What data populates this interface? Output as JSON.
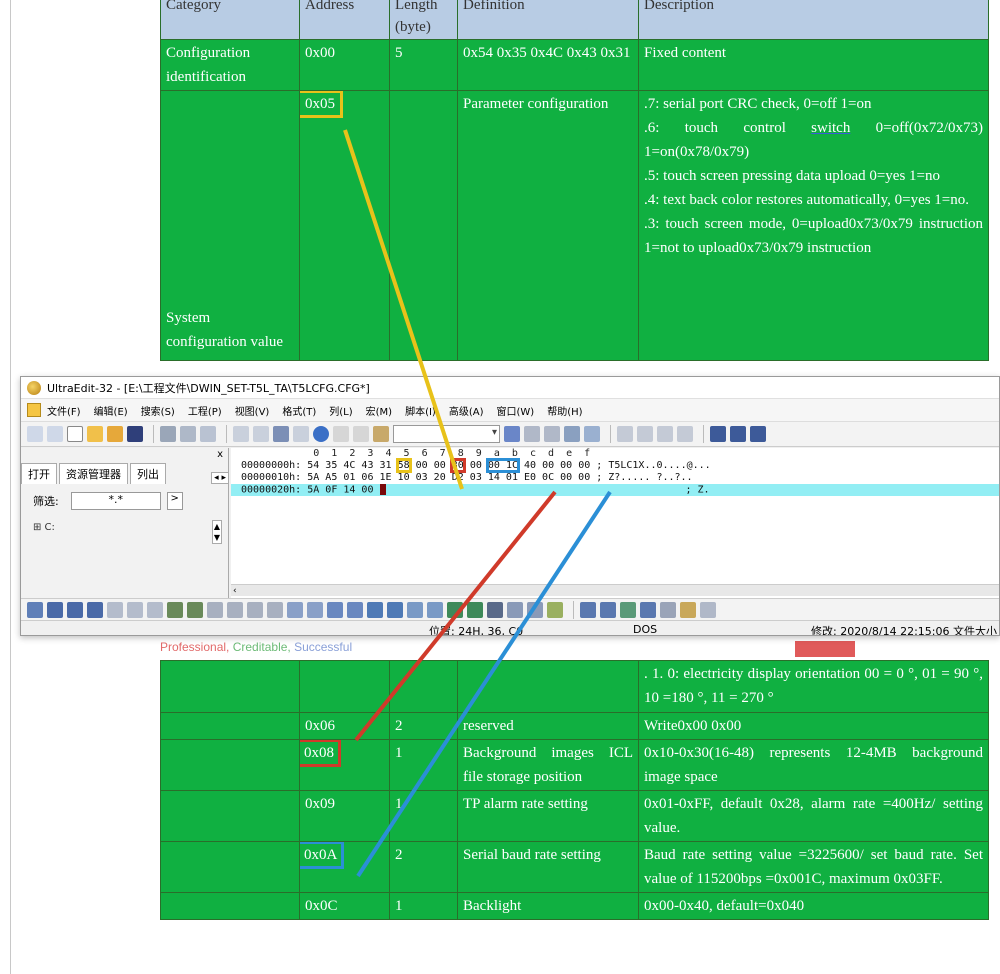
{
  "doc_table_top": {
    "headers": [
      "Category",
      "Address",
      "Length (byte)",
      "Definition",
      "Description"
    ],
    "row1": {
      "category": "Configuration identification",
      "address": "0x00",
      "length": "5",
      "definition": "0x54 0x35 0x4C 0x43 0x31",
      "description": "Fixed content"
    },
    "row2": {
      "category": "System configuration value",
      "address": "0x05",
      "definition": "Parameter configuration",
      "desc": {
        "l1": ".7: serial port CRC check, 0=off 1=on",
        "l2a": ".6: touch control ",
        "l2link": "switch",
        "l2b": " 0=off(0x72/0x73) 1=on(0x78/0x79)",
        "l3": ".5: touch screen pressing data upload 0=yes 1=no",
        "l4": ".4: text back color restores automatically, 0=yes 1=no.",
        "l5": ".3: touch screen mode, 0=upload0x73/0x79 instruction 1=not to upload0x73/0x79 instruction"
      }
    }
  },
  "slogan": {
    "professional": "Professional,",
    "creditable": " Creditable,",
    "successful": " Successful"
  },
  "editor_window": {
    "title": "UltraEdit-32 - [E:\\工程文件\\DWIN_SET-T5L_TA\\T5LCFG.CFG*]",
    "menu": [
      "文件(F)",
      "编辑(E)",
      "搜索(S)",
      "工程(P)",
      "视图(V)",
      "格式(T)",
      "列(L)",
      "宏(M)",
      "脚本(I)",
      "高级(A)",
      "窗口(W)",
      "帮助(H)"
    ],
    "left_pane": {
      "close": "x",
      "tabs": [
        "打开",
        "资源管理器",
        "列出"
      ],
      "filter_label": "筛选:",
      "filter_value": "*.*",
      "drive": "⊞ C:"
    },
    "hex": {
      "ruler": "            0  1  2  3  4  5  6  7  8  9  a  b  c  d  e  f",
      "rows": [
        {
          "addr": "00000000h:",
          "p1": "54 35 4C 43 31 ",
          "b05": "58",
          "p2": " 00 00 ",
          "b08": "30",
          "p3": " 00 ",
          "b0a": "00 1C",
          "p4": " 40 00 00 00",
          "ascii": " ; T5LC1X..0....@..."
        },
        {
          "addr": "00000010h:",
          "bytes": "5A A5 01 06 1E 10 03 20 D2 03 14 01 E0 0C 00 00",
          "ascii": " ; Z?..... ?..?.."
        },
        {
          "addr": "00000020h:",
          "bytes": "5A 0F 14 00 ",
          "ascii": "; Z."
        }
      ]
    },
    "status": {
      "position": "位置: 24H, 36, C0",
      "mode": "DOS",
      "modified": "修改: 2020/8/14 22:15:06",
      "filesize": "文件大小"
    }
  },
  "doc_table_bottom": {
    "row_orientation": {
      "description": ". 1. 0: electricity display orientation 00 = 0 °, 01 = 90 °, 10 =180 °, 11 = 270 °"
    },
    "row_reserved": {
      "address": "0x06",
      "length": "2",
      "definition": "reserved",
      "description": "Write0x00 0x00"
    },
    "row_bg": {
      "address": "0x08",
      "length": "1",
      "definition": "Background images ICL file storage position",
      "description": "0x10-0x30(16-48) represents 12-4MB background image space"
    },
    "row_tp": {
      "address": "0x09",
      "length": "1",
      "definition": "TP alarm rate setting",
      "description": "0x01-0xFF, default 0x28, alarm rate =400Hz/ setting value."
    },
    "row_baud": {
      "address": "0x0A",
      "length": "2",
      "definition": "Serial baud rate setting",
      "description": "Baud rate setting value =3225600/ set baud rate. Set value of 115200bps =0x001C, maximum 0x03FF."
    },
    "row_backlight": {
      "address": "0x0C",
      "length": "1",
      "definition": "Backlight",
      "description": "0x00-0x40, default=0x040"
    }
  },
  "colors": {
    "table_green": "#10b041",
    "header_blue": "#b8cce4",
    "highlight_yellow": "#e8c21a",
    "highlight_red": "#d03a2a",
    "highlight_blue": "#2b8fd6",
    "selection_cyan": "#92eef4"
  }
}
